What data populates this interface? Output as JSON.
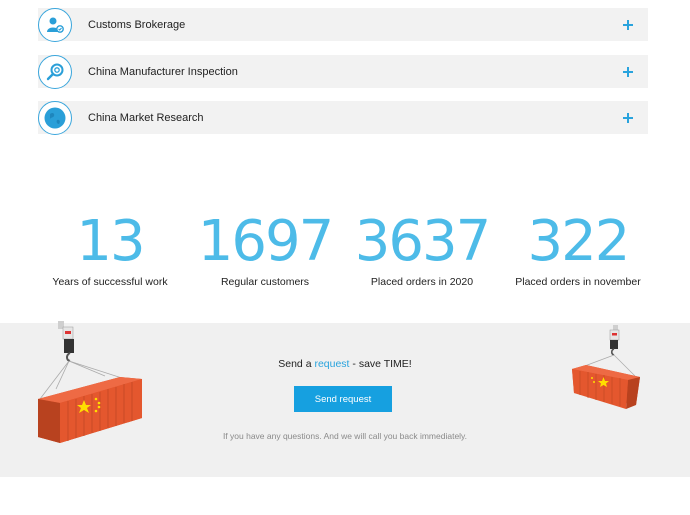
{
  "accordion": {
    "items": [
      {
        "label": "Customs Brokerage",
        "icon": "user-badge-icon"
      },
      {
        "label": "China Manufacturer Inspection",
        "icon": "magnifier-icon"
      },
      {
        "label": "China Market Research",
        "icon": "globe-icon"
      }
    ]
  },
  "stats": [
    {
      "value": "13",
      "label": "Years of successful work"
    },
    {
      "value": "1697",
      "label": "Regular customers"
    },
    {
      "value": "3637",
      "label": "Placed orders in 2020"
    },
    {
      "value": "322",
      "label": "Placed orders in november"
    }
  ],
  "request": {
    "prefix": "Send a ",
    "link": "request",
    "suffix": " - save TIME!",
    "button": "Send request",
    "note": "If you have any questions. And we will call you back immediately."
  },
  "colors": {
    "accent": "#29a3dd",
    "stat_number": "#4dbbe8",
    "button": "#16a0e0",
    "container": "#e4572e"
  }
}
